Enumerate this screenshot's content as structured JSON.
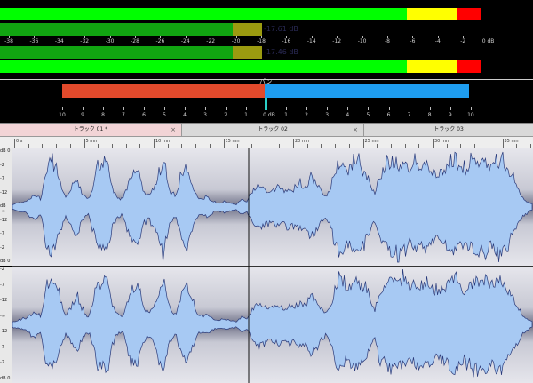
{
  "level_meter": {
    "scale_labels": [
      "-38",
      "-36",
      "-34",
      "-32",
      "-30",
      "-28",
      "-26",
      "-24",
      "-22",
      "-20",
      "-18",
      "-16",
      "-14",
      "-12",
      "-10",
      "-8",
      "-6",
      "-4",
      "-2",
      "0 dB"
    ],
    "left": {
      "peak_level": 0.9,
      "rms_level": 0.48,
      "readout": "-17.61 dB"
    },
    "right": {
      "peak_level": 0.9,
      "rms_level": 0.48,
      "readout": "-17.46 dB"
    },
    "colors": {
      "green": "#00ff00",
      "dark_green": "#11a511",
      "olive": "#9b9b10",
      "yellow": "#ffff00",
      "red": "#ff0000"
    }
  },
  "pan_meter": {
    "title": "パン",
    "left_scale": [
      "10",
      "9",
      "8",
      "7",
      "6",
      "5",
      "4",
      "3",
      "2",
      "1"
    ],
    "center_label": "0 dB",
    "right_scale": [
      "1",
      "2",
      "3",
      "4",
      "5",
      "6",
      "7",
      "8",
      "9",
      "10"
    ],
    "colors": {
      "left": "#e24a2c",
      "right": "#1e9df0",
      "center": "#2ad0c8"
    }
  },
  "tabs": [
    {
      "label": "トラック 01 *",
      "active": true
    },
    {
      "label": "トラック 02",
      "active": false
    },
    {
      "label": "トラック 03",
      "active": false
    }
  ],
  "close_glyph": "×",
  "ruler": {
    "labels": [
      "0 s",
      "5 mn",
      "10 mn",
      "15 mn",
      "20 mn",
      "25 mn",
      "30 mn",
      "35 mn"
    ]
  },
  "channels": {
    "top_labels": [
      "dB 0",
      "-2",
      "-7",
      "-12",
      "dB -∞",
      "-12",
      "-7",
      "-2",
      "dB 0"
    ],
    "bottom_labels": [
      "-2",
      "-7",
      "-12",
      "-∞",
      "-12",
      "-7",
      "-2",
      "dB 0"
    ],
    "colors": {
      "fill": "#a7c9f3",
      "stroke": "#2a3a7a",
      "bg_top": "#e6e6ec",
      "bg_mid": "#6e7086"
    }
  }
}
